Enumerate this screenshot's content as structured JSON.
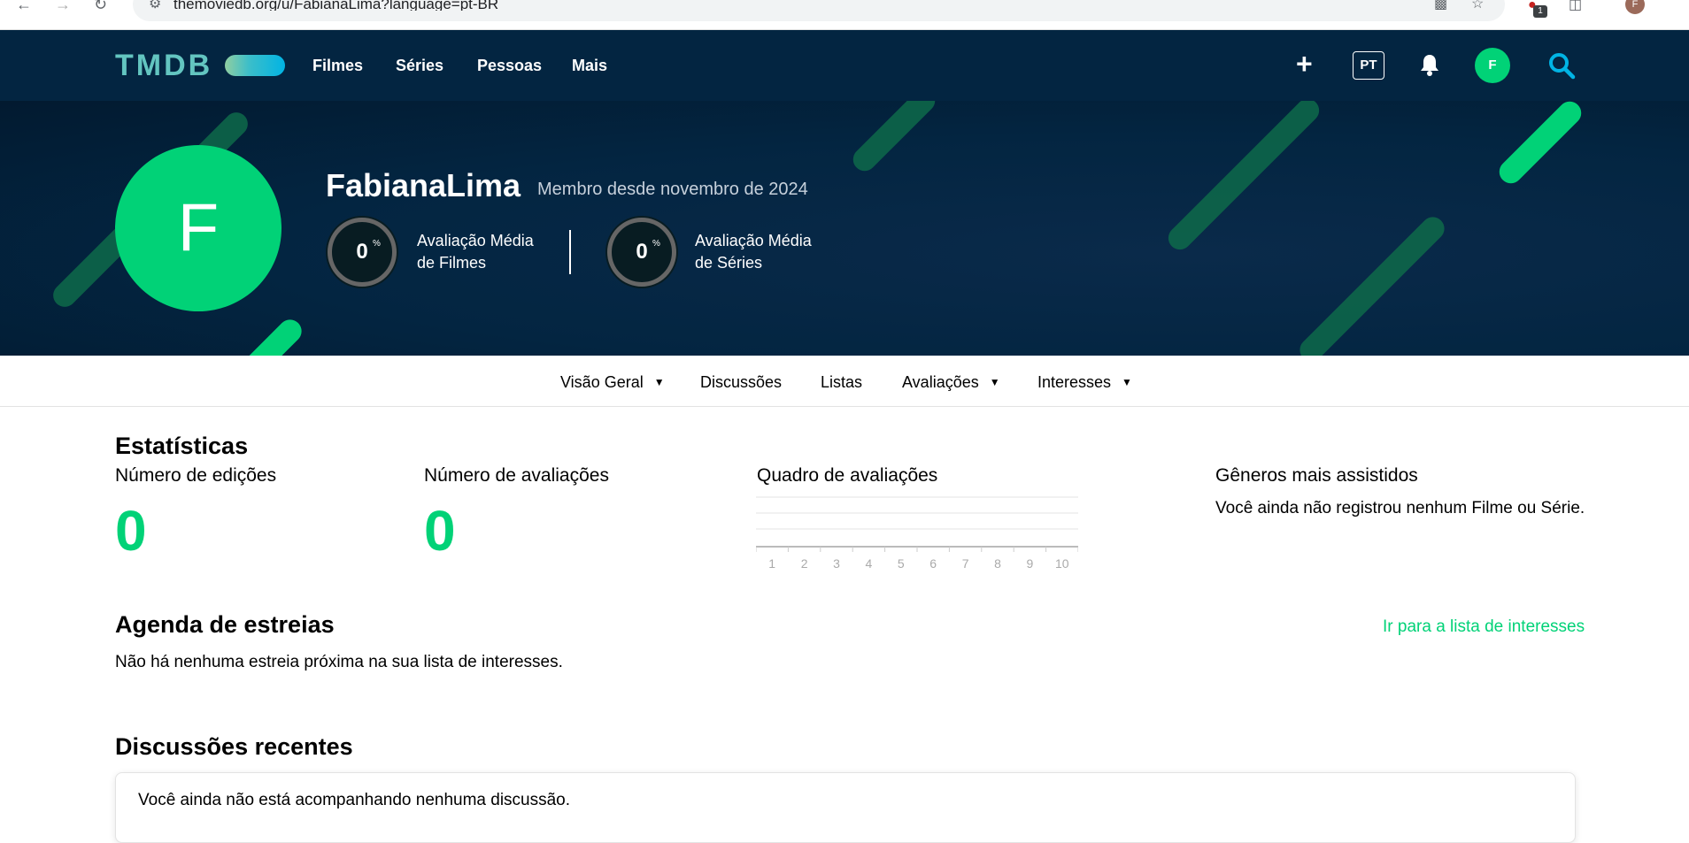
{
  "browser": {
    "url": "themoviedb.org/u/FabianaLima?language=pt-BR",
    "extension_badge": "1",
    "profile_initial": "F"
  },
  "header": {
    "logo": "TMDB",
    "nav": [
      "Filmes",
      "Séries",
      "Pessoas",
      "Mais"
    ],
    "lang": "PT",
    "avatar_initial": "F"
  },
  "profile": {
    "initial": "F",
    "username": "FabianaLima",
    "member_since": "Membro desde novembro de 2024",
    "movie_score": "0",
    "movie_score_label_1": "Avaliação Média",
    "movie_score_label_2": "de Filmes",
    "tv_score": "0",
    "tv_score_label_1": "Avaliação Média",
    "tv_score_label_2": "de Séries",
    "percent_sign": "%"
  },
  "subnav": [
    "Visão Geral",
    "Discussões",
    "Listas",
    "Avaliações",
    "Interesses"
  ],
  "stats": {
    "title": "Estatísticas",
    "edits_label": "Número de edições",
    "edits_value": "0",
    "ratings_label": "Número de avaliações",
    "ratings_value": "0",
    "chart_label": "Quadro de avaliações",
    "genres_label": "Gêneros mais assistidos",
    "genres_empty": "Você ainda não registrou nenhum Filme ou Série."
  },
  "chart_data": {
    "type": "bar",
    "title": "Quadro de avaliações",
    "categories": [
      "1",
      "2",
      "3",
      "4",
      "5",
      "6",
      "7",
      "8",
      "9",
      "10"
    ],
    "values": [
      0,
      0,
      0,
      0,
      0,
      0,
      0,
      0,
      0,
      0
    ]
  },
  "agenda": {
    "title": "Agenda de estreias",
    "link": "Ir para a lista de interesses",
    "empty": "Não há nenhuma estreia próxima na sua lista de interesses."
  },
  "discussions": {
    "title": "Discussões recentes",
    "empty": "Você ainda não está acompanhando nenhuma discussão."
  },
  "colors": {
    "tmdb_navy": "#032541",
    "tmdb_green": "#01d277",
    "tmdb_blue": "#01b4e4"
  }
}
